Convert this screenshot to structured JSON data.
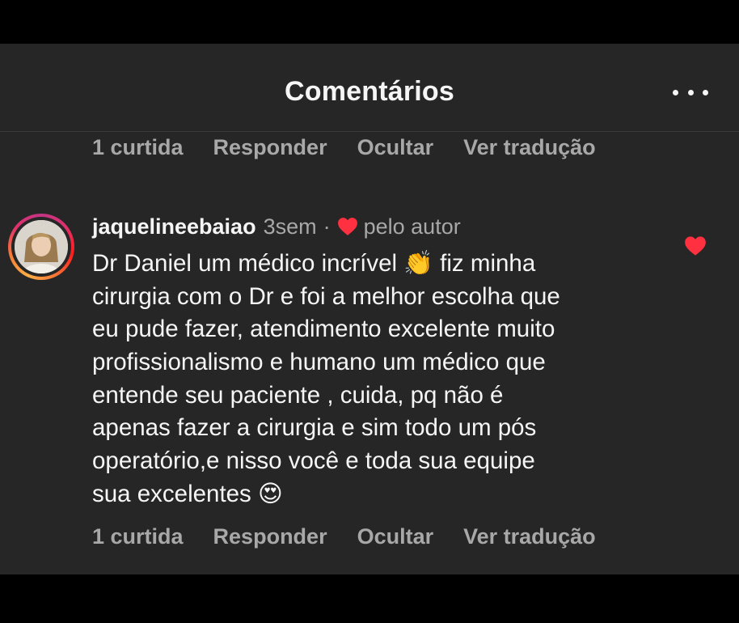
{
  "header": {
    "title": "Comentários",
    "more_icon": "more-horizontal-icon"
  },
  "previous_comment_actions": {
    "likes": "1 curtida",
    "reply": "Responder",
    "hide": "Ocultar",
    "translate": "Ver tradução"
  },
  "comment": {
    "username": "jaquelineebaiao",
    "time": "3sem",
    "separator": "·",
    "liked_by_author": "pelo autor",
    "lines": [
      "Dr Daniel um médico incrível 👏 fiz minha",
      "cirurgia com o Dr e foi a melhor escolha que",
      "eu pude fazer, atendimento excelente muito",
      "profissionalismo e humano um médico que",
      "entende seu paciente , cuida, pq não é",
      "apenas fazer a cirurgia e sim todo um pós",
      "operatório,e nisso você e toda sua equipe",
      "sua excelentes 😍"
    ],
    "actions": {
      "likes": "1 curtida",
      "reply": "Responder",
      "hide": "Ocultar",
      "translate": "Ver tradução"
    },
    "liked": true
  },
  "colors": {
    "background": "#262626",
    "text": "#f5f5f5",
    "secondary_text": "#a8a8a8",
    "heart": "#ff3040"
  }
}
